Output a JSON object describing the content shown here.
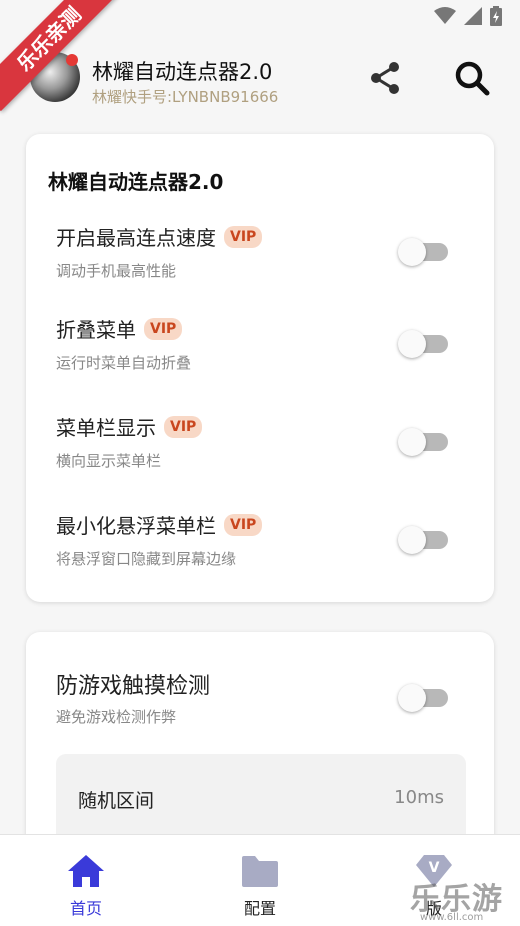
{
  "status_bar": {
    "icons": [
      "wifi-icon",
      "signal-icon",
      "battery-icon"
    ]
  },
  "ribbon": {
    "text": "乐乐亲测"
  },
  "header": {
    "title": "林耀自动连点器2.0",
    "subtitle": "林耀快手号:LYNBNB91666",
    "share_icon": "share-icon",
    "search_icon": "search-icon"
  },
  "card1": {
    "title": "林耀自动连点器2.0",
    "settings": [
      {
        "label": "开启最高连点速度",
        "badge": "VIP",
        "desc": "调动手机最高性能",
        "enabled": false
      },
      {
        "label": "折叠菜单",
        "badge": "VIP",
        "desc": "运行时菜单自动折叠",
        "enabled": false
      },
      {
        "label": "菜单栏显示",
        "badge": "VIP",
        "desc": "横向显示菜单栏",
        "enabled": false
      },
      {
        "label": "最小化悬浮菜单栏",
        "badge": "VIP",
        "desc": "将悬浮窗口隐藏到屏幕边缘",
        "enabled": false
      }
    ]
  },
  "card2": {
    "setting": {
      "label": "防游戏触摸检测",
      "desc": "避免游戏检测作弊",
      "enabled": false
    },
    "random": {
      "label": "随机区间",
      "value": "10ms"
    }
  },
  "bottom_nav": {
    "items": [
      {
        "label": "首页",
        "icon": "home-icon",
        "active": true
      },
      {
        "label": "配置",
        "icon": "folder-icon",
        "active": false
      },
      {
        "label": "版",
        "icon": "vip-diamond-icon",
        "active": false
      }
    ]
  },
  "watermark": {
    "text": "乐乐游戏",
    "url": "www.6ll.com"
  },
  "colors": {
    "accent": "#3a3ad9",
    "vip_bg": "#f8d8c6",
    "vip_text": "#c9461e",
    "ribbon": "#d9363e"
  }
}
